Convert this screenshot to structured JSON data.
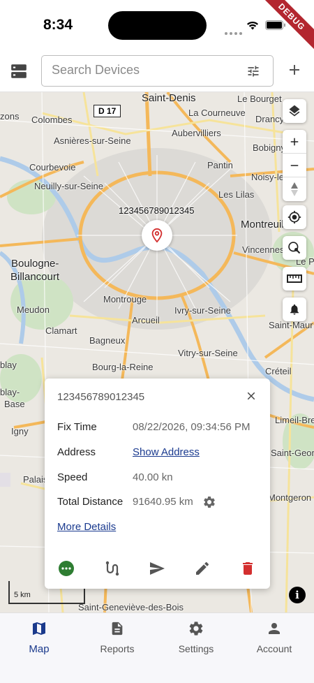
{
  "status": {
    "time": "8:34",
    "debug_banner": "DEBUG"
  },
  "appbar": {
    "search_placeholder": "Search Devices"
  },
  "map": {
    "places": [
      {
        "name": "Saint-Denis",
        "big": true
      },
      {
        "name": "Le Bourget"
      },
      {
        "name": "La Courneuve"
      },
      {
        "name": "Drancy"
      },
      {
        "name": "zons"
      },
      {
        "name": "Colombes"
      },
      {
        "name": "Aubervilliers"
      },
      {
        "name": "Asnières-sur-Seine"
      },
      {
        "name": "Bobigny"
      },
      {
        "name": "Courbevoie"
      },
      {
        "name": "Pantin"
      },
      {
        "name": "Noisy-le-"
      },
      {
        "name": "Neuilly-sur-Seine"
      },
      {
        "name": "Les Lilas"
      },
      {
        "name": "Montreuil",
        "big": true
      },
      {
        "name": "Vincennes"
      },
      {
        "name": "Le Pe"
      },
      {
        "name": "Boulogne-",
        "big": true
      },
      {
        "name": "Billancourt",
        "big": true
      },
      {
        "name": "Montrouge"
      },
      {
        "name": "Meudon"
      },
      {
        "name": "Ivry-sur-Seine"
      },
      {
        "name": "Arcueil"
      },
      {
        "name": "Saint-Maur"
      },
      {
        "name": "Clamart"
      },
      {
        "name": "Bagneux"
      },
      {
        "name": "Vitry-sur-Seine"
      },
      {
        "name": "blay"
      },
      {
        "name": "Bourg-la-Reine"
      },
      {
        "name": "Créteil"
      },
      {
        "name": "blay-"
      },
      {
        "name": "Base"
      },
      {
        "name": "Limeil-Bre"
      },
      {
        "name": "Igny"
      },
      {
        "name": "Saint-Georg"
      },
      {
        "name": "Palais"
      },
      {
        "name": "Montgeron"
      },
      {
        "name": "Saint-Geneviève-des-Bois"
      }
    ],
    "road_shield": "D 17",
    "marker_label": "123456789012345",
    "scale_label": "5 km",
    "info_icon": "i"
  },
  "popup": {
    "title": "123456789012345",
    "rows": [
      {
        "key": "Fix Time",
        "value": "08/22/2026, 09:34:56 PM"
      },
      {
        "key": "Address",
        "value": "Show Address"
      },
      {
        "key": "Speed",
        "value": "40.00 kn"
      },
      {
        "key": "Total Distance",
        "value": "91640.95 km"
      }
    ],
    "more_details": "More Details",
    "colors": {
      "more_action": "#2e7d32",
      "delete_action": "#d32f2f",
      "accent": "#1b3a8c"
    }
  },
  "nav": {
    "tabs": [
      {
        "label": "Map",
        "icon": "map-icon"
      },
      {
        "label": "Reports",
        "icon": "description-icon"
      },
      {
        "label": "Settings",
        "icon": "gear-icon"
      },
      {
        "label": "Account",
        "icon": "person-icon"
      }
    ]
  }
}
